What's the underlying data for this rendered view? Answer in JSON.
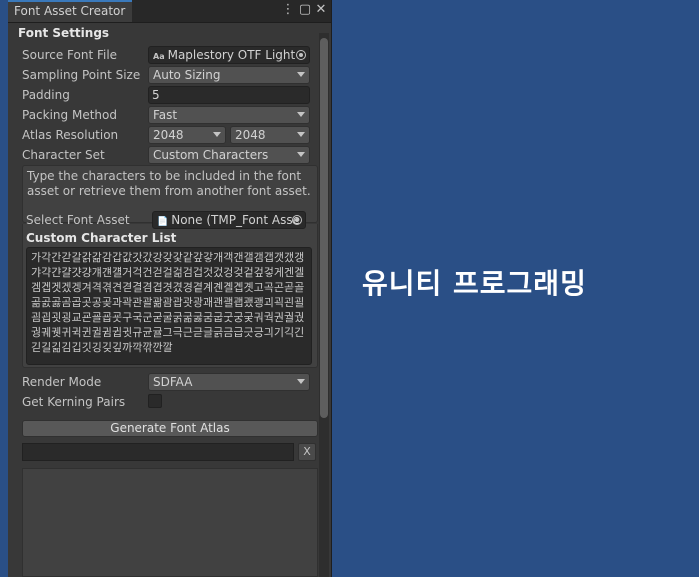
{
  "window": {
    "tab_title": "Font Asset Creator",
    "menu_icon": "kebab-menu-icon",
    "close_icon": "close-icon"
  },
  "font_settings": {
    "section_title": "Font Settings",
    "source_font_file": {
      "label": "Source Font File",
      "value": "Maplestory OTF Light",
      "icon": "font-asset-icon",
      "icon_text": "Aa"
    },
    "sampling_point_size": {
      "label": "Sampling Point Size",
      "value": "Auto Sizing"
    },
    "padding": {
      "label": "Padding",
      "value": "5"
    },
    "packing_method": {
      "label": "Packing Method",
      "value": "Fast"
    },
    "atlas_resolution": {
      "label": "Atlas Resolution",
      "width": "2048",
      "height": "2048"
    },
    "character_set": {
      "label": "Character Set",
      "value": "Custom Characters"
    },
    "help_text": "Type the characters to be included in the font asset or retrieve them from another font asset.",
    "select_font_asset": {
      "label": "Select Font Asset",
      "value": "None (TMP_Font Asse",
      "icon": "document-icon"
    },
    "custom_character_list": {
      "label": "Custom Character List",
      "value": "가각간갇갈갉갊감갑값갓갔강갖갗같갚갛개객갠갤갬갭갯갰갱갸갹갼걀걋걍걔걘걜거걱건걷걸걺검겁것겄겅겆겉겊겋게겐겔겜겝겟겠겡겨격겪견겯결겸겹겻겼경곁계곈곌곕곗고곡곤곧골곪곬곯곰곱곳공곶과곽관괄괆괌괍괏광괘괜괠괩괬괭괴괵괸괼굄굅굇굉교굔굘굡굣구국군굳굴굵굶굻굼굽굿궁궂궈궉권궐궜궝궤궷귀귁귄귈귐귑귓규균귤그극근귿글긁금급긋긍긔기긱긴긷길긺김깁깃깅깆깊까깍깎깐깔"
    },
    "render_mode": {
      "label": "Render Mode",
      "value": "SDFAA"
    },
    "get_kerning_pairs": {
      "label": "Get Kerning Pairs",
      "checked": false
    },
    "generate_button": "Generate Font Atlas",
    "progress": {
      "fraction": 0,
      "cancel_label": "X"
    }
  },
  "scene_caption": "유니티 프로그래밍",
  "colors": {
    "scene_background": "#2a4f86",
    "panel_background": "#383838",
    "tab_accent": "#3a79bb"
  }
}
